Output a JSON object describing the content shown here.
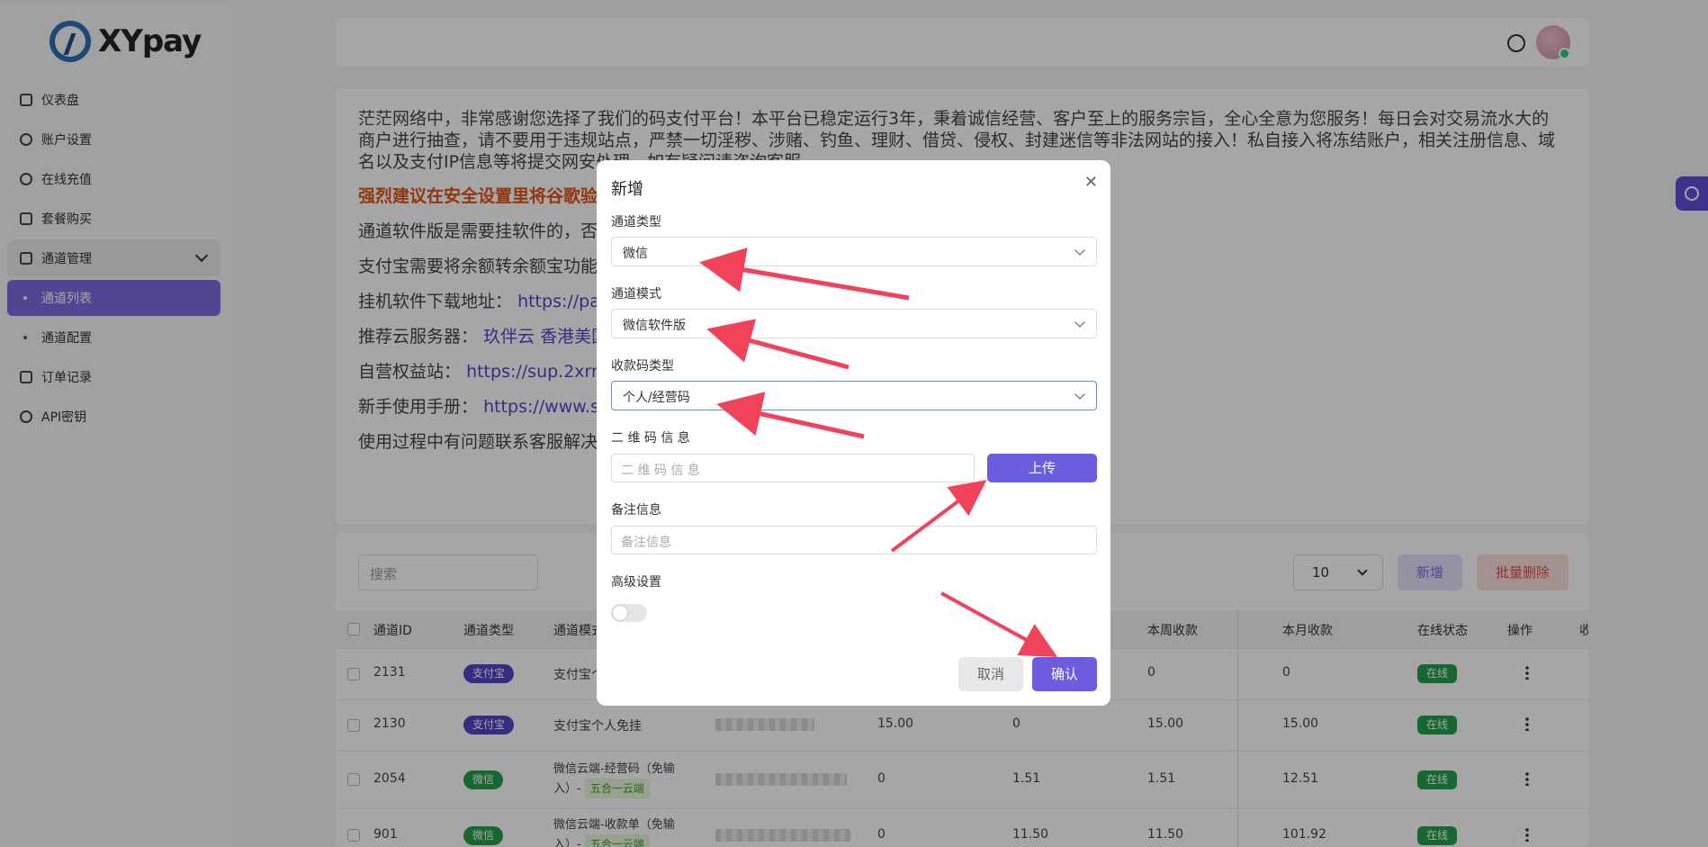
{
  "brand": {
    "name": "XYpay"
  },
  "sidebar": {
    "items": [
      {
        "label": "仪表盘",
        "icon": "dashboard-icon"
      },
      {
        "label": "账户设置",
        "icon": "user-icon"
      },
      {
        "label": "在线充值",
        "icon": "coin-icon"
      },
      {
        "label": "套餐购买",
        "icon": "package-icon"
      },
      {
        "label": "通道管理",
        "icon": "channel-icon"
      },
      {
        "label": "通道列表"
      },
      {
        "label": "通道配置"
      },
      {
        "label": "订单记录",
        "icon": "order-icon"
      },
      {
        "label": "API密钥",
        "icon": "key-icon"
      }
    ]
  },
  "notice": {
    "intro": "茫茫网络中，非常感谢您选择了我们的码支付平台！本平台已稳定运行3年，秉着诚信经营、客户至上的服务宗旨，全心全意为您服务！每日会对交易流水大的商户进行抽查，请不要用于违规站点，严禁一切淫秽、涉赌、钓鱼、理财、借贷、侵权、封建迷信等非法网站的接入！私自接入将冻结账户，相关注册信息、域名以及支付IP信息等将提交网安处理，如有疑问请咨询客服。",
    "warn": "强烈建议在安全设置里将谷歌验",
    "line1": "通道软件版是需要挂软件的，否",
    "line2": "支付宝需要将余额转余额宝功能",
    "line3_label": "挂机软件下载地址：",
    "line3_link": "https://pa",
    "line4_label": "推荐云服务器：",
    "line4_link": "玖伴云 香港美国",
    "line5_label": "自营权益站：",
    "line5_link": "https://sup.2xrr.c",
    "line6_label": "新手使用手册：",
    "line6_link": "https://www.s",
    "line7": "使用过程中有问题联系客服解决"
  },
  "table": {
    "search_placeholder": "搜索",
    "page_size": "10",
    "new_label": "新增",
    "batch_delete_label": "批量删除",
    "headers": [
      "通道ID",
      "通道类型",
      "通道模式",
      "本周收款",
      "本月收款",
      "在线状态",
      "操作",
      "收"
    ],
    "rows": [
      {
        "id": "2131",
        "type": "支付宝",
        "mode": "支付宝个",
        "c1": "",
        "c2": "",
        "week": "0",
        "month": "0",
        "status": "在线"
      },
      {
        "id": "2130",
        "type": "支付宝",
        "mode": "支付宝个人免挂",
        "c1": "15.00",
        "c2": "0",
        "week": "15.00",
        "month": "15.00",
        "status": "在线"
      },
      {
        "id": "2054",
        "type": "微信",
        "mode": "微信云端-经营码（免输",
        "mode2": "入）-",
        "tag": "五合一云端",
        "c1": "0",
        "c2": "1.51",
        "week": "1.51",
        "month": "12.51",
        "status": "在线"
      },
      {
        "id": "901",
        "type": "微信",
        "mode": "微信云端-收款单（免输",
        "mode2": "入）-",
        "tag": "五合一云端",
        "c1": "0",
        "c2": "11.50",
        "week": "11.50",
        "month": "101.92",
        "status": "在线"
      }
    ]
  },
  "modal": {
    "title": "新增",
    "channel_type_label": "通道类型",
    "channel_type_value": "微信",
    "channel_mode_label": "通道模式",
    "channel_mode_value": "微信软件版",
    "qr_type_label": "收款码类型",
    "qr_type_value": "个人/经营码",
    "qr_info_label": "二 维 码 信 息",
    "qr_info_placeholder": "二 维 码 信 息",
    "upload_label": "上传",
    "remark_label": "备注信息",
    "remark_placeholder": "备注信息",
    "advanced_label": "高级设置",
    "advanced_enabled": false,
    "cancel_label": "取消",
    "confirm_label": "确认"
  },
  "colors": {
    "accent": "#6b5ce0",
    "arrow": "#f0425a",
    "success": "#22a04b",
    "danger": "#e54b4b"
  }
}
